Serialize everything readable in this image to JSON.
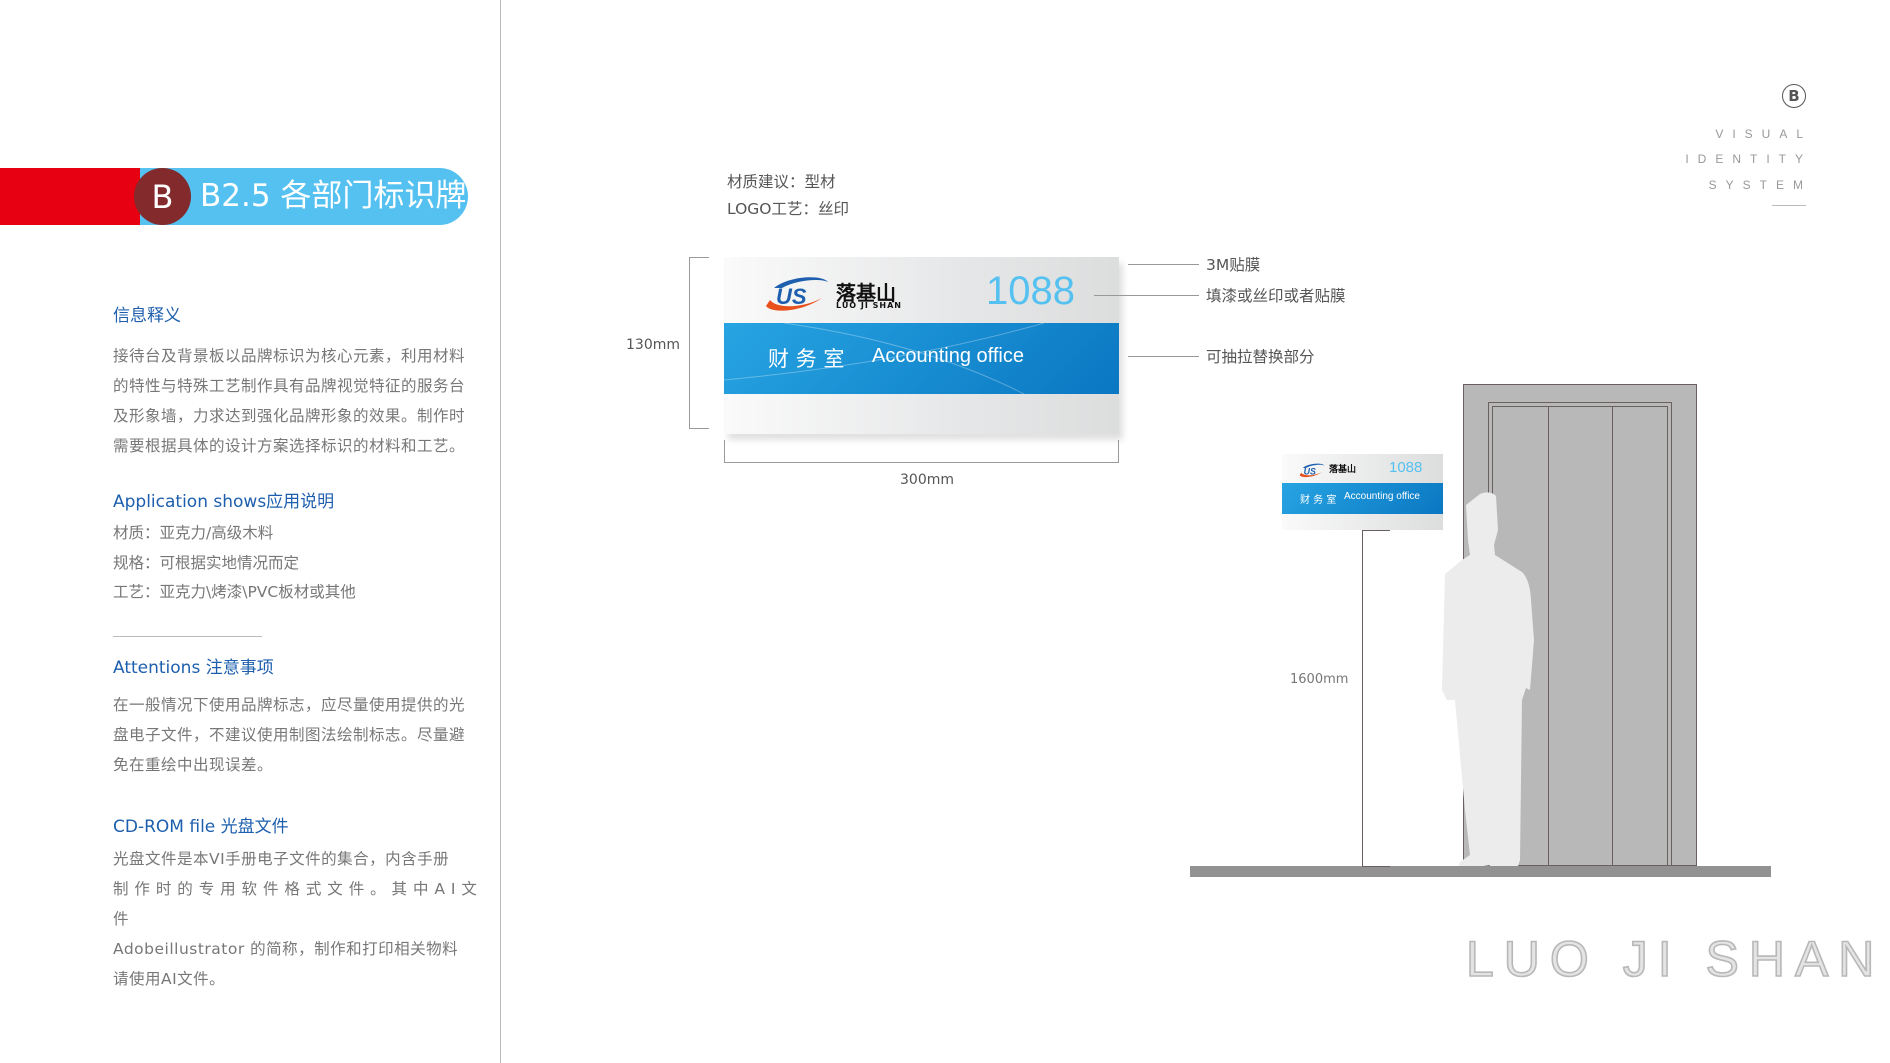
{
  "header": {
    "badge": "B",
    "title": "B2.5 各部门标识牌",
    "colors": {
      "red": "#e60012",
      "badge": "#822a2c",
      "pill": "#55c1f0"
    }
  },
  "left": {
    "info_title": "信息释义",
    "info_lines": [
      "接待台及背景板以品牌标识为核心元素，利用材料",
      "的特性与特殊工艺制作具有品牌视觉特征的服务台",
      "及形象墙，力求达到强化品牌形象的效果。制作时",
      "需要根据具体的设计方案选择标识的材料和工艺。"
    ],
    "app_title": "Application shows应用说明",
    "app_lines": [
      "材质：亚克力/高级木料",
      "规格：可根据实地情况而定",
      "工艺：亚克力\\烤漆\\PVC板材或其他"
    ],
    "att_title": "Attentions  注意事项",
    "att_lines": [
      "在一般情况下使用品牌标志，应尽量使用提供的光",
      "盘电子文件，不建议使用制图法绘制标志。尽量避",
      "免在重绘中出现误差。"
    ],
    "cd_title": "CD-ROM file 光盘文件",
    "cd_lines": [
      "光盘文件是本VI手册电子文件的集合，内含手册",
      "制 作 时 的 专 用 软 件 格 式 文 件 。 其 中 A I 文 件",
      "Adobeillustrator   的简称，制作和打印相关物料",
      "请使用AI文件。"
    ]
  },
  "spec": {
    "material": "材质建议：型材",
    "logo": "LOGO工艺：丝印"
  },
  "sign": {
    "logo_cn": "落基山",
    "logo_en": "LUO JI SHAN",
    "number": "1088",
    "room_cn": "财 务 室",
    "room_en": "Accounting office"
  },
  "callouts": [
    "3M贴膜",
    "填漆或丝印或者贴膜",
    "可抽拉替换部分"
  ],
  "dimensions": {
    "height": "130mm",
    "width": "300mm",
    "mount_height": "1600mm"
  },
  "corner": {
    "badge": "B",
    "lines": [
      "VISUAL",
      "IDENTITY",
      "SYSTEM"
    ]
  },
  "brand": "LUO JI SHAN"
}
